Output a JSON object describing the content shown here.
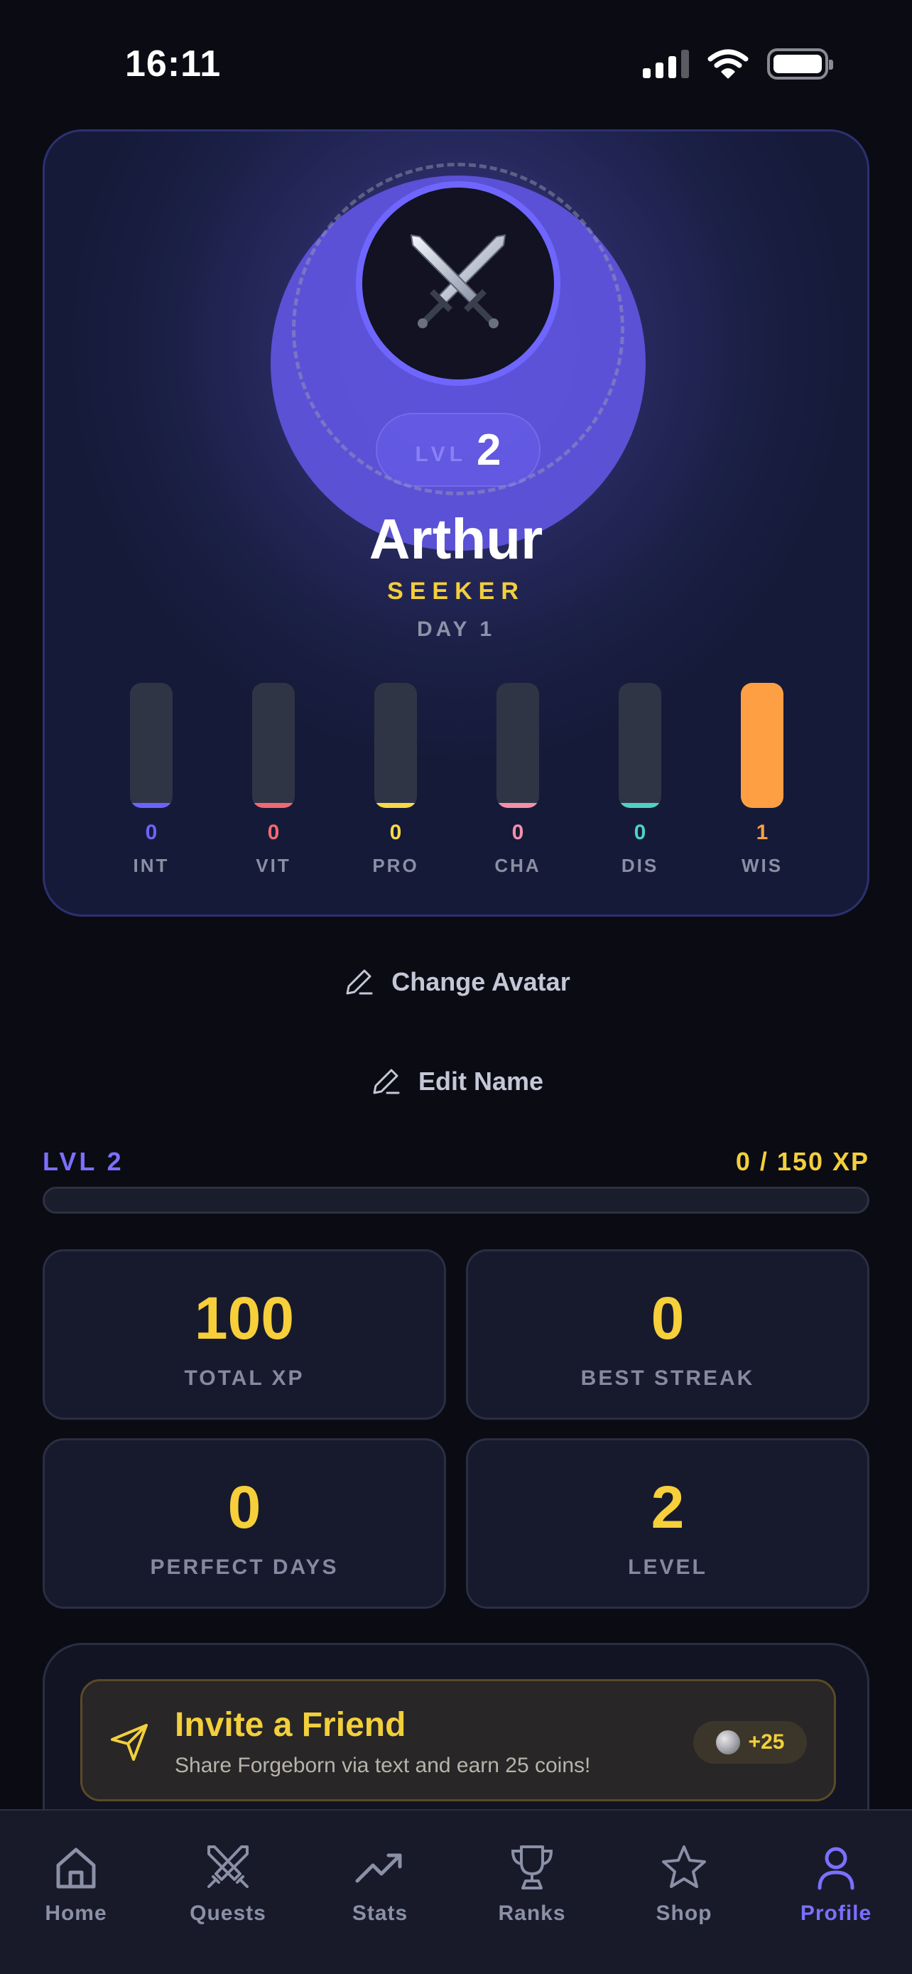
{
  "status_bar": {
    "time": "16:11"
  },
  "profile": {
    "level_label": "LVL",
    "level": "2",
    "name": "Arthur",
    "title": "SEEKER",
    "day": "DAY 1",
    "avatar_icon": "crossed-swords-icon"
  },
  "attributes": [
    {
      "abbr": "INT",
      "value": "0",
      "color": "#6b63ff",
      "level": 0.04
    },
    {
      "abbr": "VIT",
      "value": "0",
      "color": "#ef6a72",
      "level": 0.04
    },
    {
      "abbr": "PRO",
      "value": "0",
      "color": "#f6d94a",
      "level": 0.04
    },
    {
      "abbr": "CHA",
      "value": "0",
      "color": "#f291a9",
      "level": 0.04
    },
    {
      "abbr": "DIS",
      "value": "0",
      "color": "#4fd1c5",
      "level": 0.04
    },
    {
      "abbr": "WIS",
      "value": "1",
      "color": "#ff9f43",
      "level": 1.0
    }
  ],
  "actions": {
    "change_avatar": "Change Avatar",
    "edit_name": "Edit Name"
  },
  "xp": {
    "level_text": "LVL 2",
    "progress_text": "0 / 150 XP",
    "progress": 0
  },
  "stats": [
    {
      "value": "100",
      "label": "TOTAL XP"
    },
    {
      "value": "0",
      "label": "BEST STREAK"
    },
    {
      "value": "0",
      "label": "PERFECT DAYS"
    },
    {
      "value": "2",
      "label": "LEVEL"
    }
  ],
  "invite": {
    "title": "Invite a Friend",
    "subtitle": "Share Forgeborn via text and earn 25 coins!",
    "reward": "+25"
  },
  "tabs": [
    {
      "label": "Home",
      "icon": "home-icon",
      "active": false
    },
    {
      "label": "Quests",
      "icon": "crossed-swords-icon",
      "active": false
    },
    {
      "label": "Stats",
      "icon": "trending-up-icon",
      "active": false
    },
    {
      "label": "Ranks",
      "icon": "trophy-icon",
      "active": false
    },
    {
      "label": "Shop",
      "icon": "star-icon",
      "active": false
    },
    {
      "label": "Profile",
      "icon": "user-icon",
      "active": true
    }
  ],
  "colors": {
    "accent": "#7b70ff",
    "gold": "#f2cf3c",
    "background": "#0b0b14"
  }
}
